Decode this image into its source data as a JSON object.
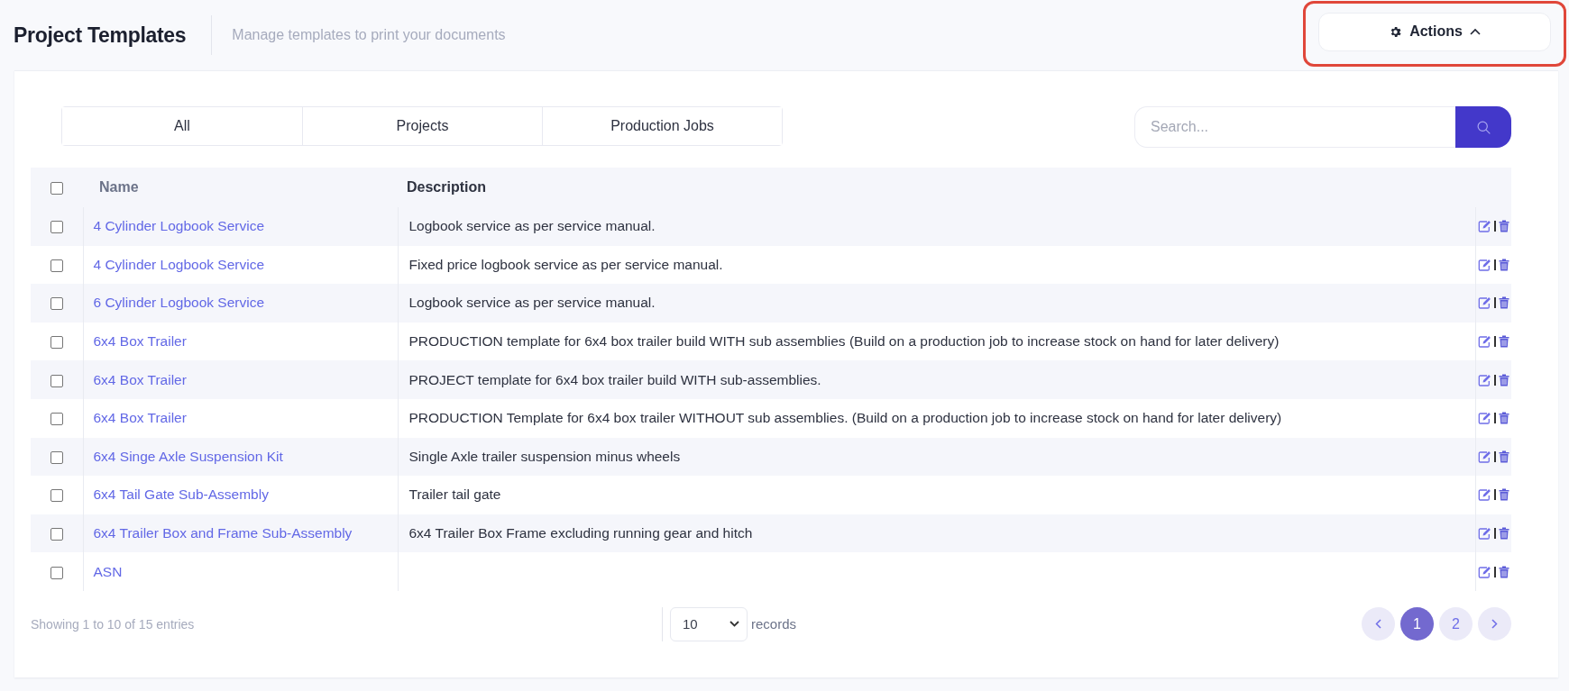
{
  "header": {
    "title": "Project Templates",
    "subtitle": "Manage templates to print your documents",
    "actions_button": {
      "label": "Actions",
      "expanded": true,
      "highlighted": true
    }
  },
  "tabs": [
    {
      "label": "All",
      "selected": false
    },
    {
      "label": "Projects",
      "selected": false
    },
    {
      "label": "Production Jobs",
      "selected": false
    }
  ],
  "search": {
    "placeholder": "Search..."
  },
  "table": {
    "select_all_checked": false,
    "columns": [
      "Name",
      "Description"
    ],
    "rows": [
      {
        "checked": false,
        "name": "4 Cylinder Logbook Service",
        "description": "Logbook service as per service manual."
      },
      {
        "checked": false,
        "name": "4 Cylinder Logbook Service",
        "description": "Fixed price logbook service as per service manual."
      },
      {
        "checked": false,
        "name": "6 Cylinder Logbook Service",
        "description": "Logbook service as per service manual."
      },
      {
        "checked": false,
        "name": "6x4 Box Trailer",
        "description": "PRODUCTION template for 6x4 box trailer build WITH sub assemblies (Build on a production job to increase stock on hand for later delivery)"
      },
      {
        "checked": false,
        "name": "6x4 Box Trailer",
        "description": "PROJECT template for 6x4 box trailer build WITH sub-assemblies."
      },
      {
        "checked": false,
        "name": "6x4 Box Trailer",
        "description": "PRODUCTION Template for 6x4 box trailer WITHOUT sub assemblies. (Build on a production job to increase stock on hand for later delivery)"
      },
      {
        "checked": false,
        "name": "6x4 Singe Axle Suspension Kit",
        "description": "Single Axle trailer suspension minus wheels"
      },
      {
        "checked": false,
        "name": "6x4 Tail Gate Sub-Assembly",
        "description": "Trailer tail gate"
      },
      {
        "checked": false,
        "name": "6x4 Trailer Box and Frame Sub-Assembly",
        "description": "6x4 Trailer Box Frame excluding running gear and hitch"
      },
      {
        "checked": false,
        "name": "ASN",
        "description": ""
      }
    ]
  },
  "footer": {
    "summary": "Showing 1 to 10 of 15 entries",
    "page_size": "10",
    "page_size_label": "records",
    "pages": [
      {
        "label": "1",
        "selected": true
      },
      {
        "label": "2",
        "selected": false
      }
    ]
  }
}
